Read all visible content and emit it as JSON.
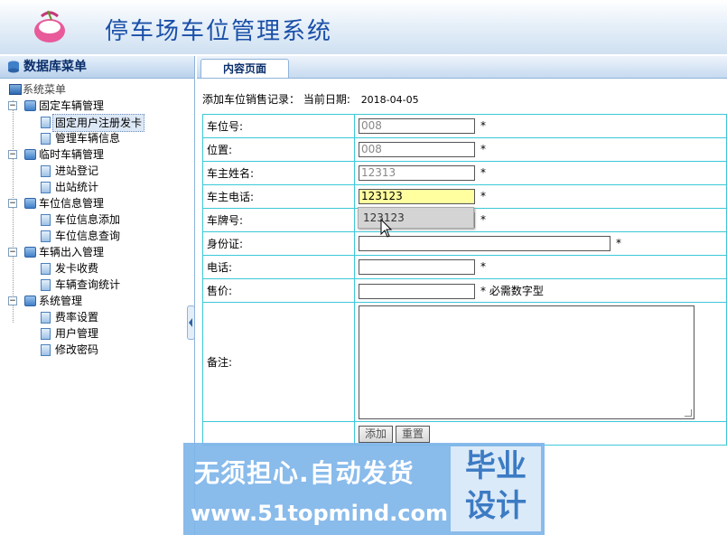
{
  "header": {
    "title": "停车场车位管理系统"
  },
  "sidebar": {
    "title": "数据库菜单",
    "root": "系统菜单",
    "groups": [
      {
        "label": "固定车辆管理",
        "items": [
          "固定用户注册发卡",
          "管理车辆信息"
        ]
      },
      {
        "label": "临时车辆管理",
        "items": [
          "进站登记",
          "出站统计"
        ]
      },
      {
        "label": "车位信息管理",
        "items": [
          "车位信息添加",
          "车位信息查询"
        ]
      },
      {
        "label": "车辆出入管理",
        "items": [
          "发卡收费",
          "车辆查询统计"
        ]
      },
      {
        "label": "系统管理",
        "items": [
          "费率设置",
          "用户管理",
          "修改密码"
        ]
      }
    ],
    "selected_item": "固定用户注册发卡"
  },
  "content": {
    "tab": "内容页面",
    "caption": "添加车位销售记录：  当前日期:",
    "date": "2018-04-05",
    "fields": [
      {
        "label": "车位号:",
        "value": "008",
        "required": "*"
      },
      {
        "label": "位置:",
        "value": "008",
        "required": "*"
      },
      {
        "label": "车主姓名:",
        "value": "12313",
        "required": "*"
      },
      {
        "label": "车主电话:",
        "value": "123123",
        "required": "*"
      },
      {
        "label": "车牌号:",
        "value": "",
        "required": "*"
      },
      {
        "label": "身份证:",
        "value": "",
        "required": "*"
      },
      {
        "label": "电话:",
        "value": "",
        "required": "*"
      },
      {
        "label": "售价:",
        "value": "",
        "required": "*",
        "hint": "必需数字型"
      },
      {
        "label": "备注:",
        "value": ""
      }
    ],
    "autocomplete_option": "123123",
    "buttons": {
      "add": "添加",
      "reset": "重置"
    }
  },
  "watermark": {
    "line1": "无须担心.自动发货",
    "line2": "www.51topmind.com",
    "badge_top": "毕业",
    "badge_bottom": "设计"
  },
  "colors": {
    "header_title": "#1a4fa8",
    "table_border": "#3cc8d8",
    "highlight_input": "#ffffa0"
  }
}
